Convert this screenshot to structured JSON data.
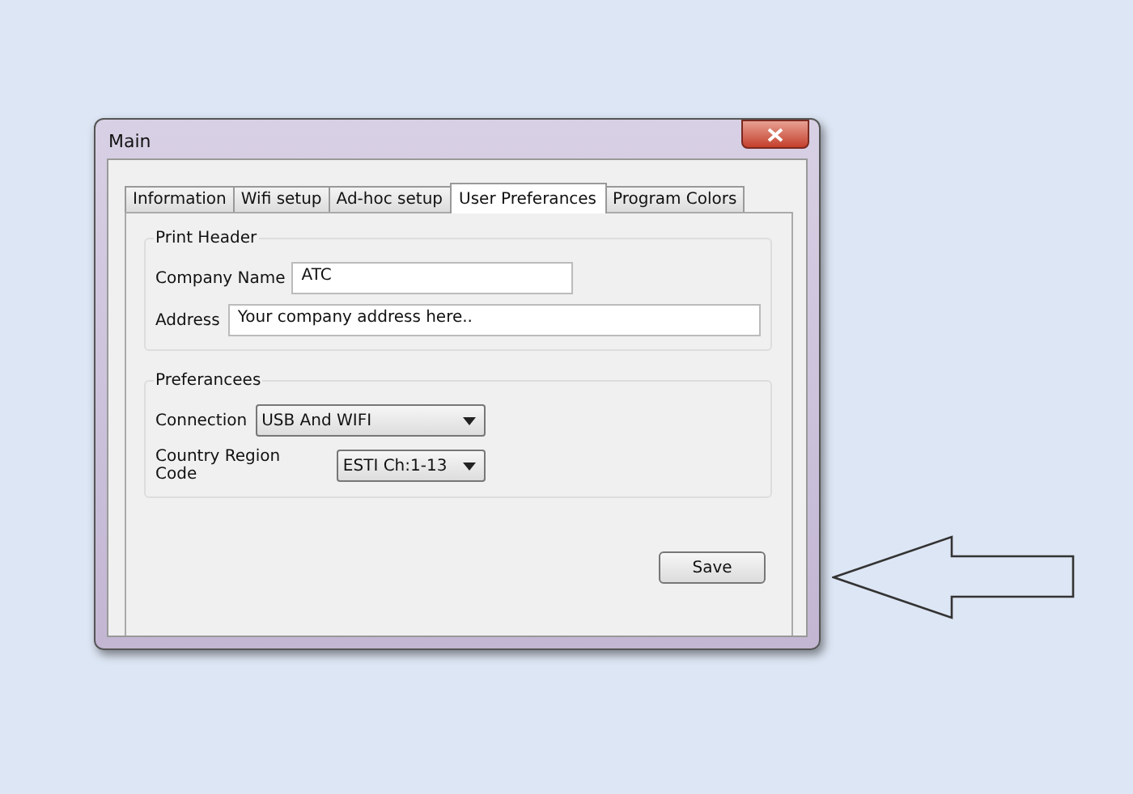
{
  "window": {
    "title": "Main"
  },
  "tabs": [
    {
      "label": "Information",
      "selected": false
    },
    {
      "label": "Wifi setup",
      "selected": false
    },
    {
      "label": "Ad-hoc setup",
      "selected": false
    },
    {
      "label": "User Preferances",
      "selected": true
    },
    {
      "label": "Program Colors",
      "selected": false
    }
  ],
  "print_header": {
    "title": "Print Header",
    "fields": [
      {
        "label": "Company Name",
        "value": "ATC",
        "kind": "short"
      },
      {
        "label": "Address",
        "value": "Your company address here..",
        "kind": "long"
      }
    ]
  },
  "preferences": {
    "title": "Preferancees",
    "dropdowns": [
      {
        "label": "Connection",
        "value": "USB And WIFI",
        "kind": "wide"
      },
      {
        "label": "Country Region Code",
        "value": "ESTI Ch:1-13",
        "kind": "narrow"
      }
    ]
  },
  "buttons": [
    {
      "label": "Save"
    }
  ]
}
